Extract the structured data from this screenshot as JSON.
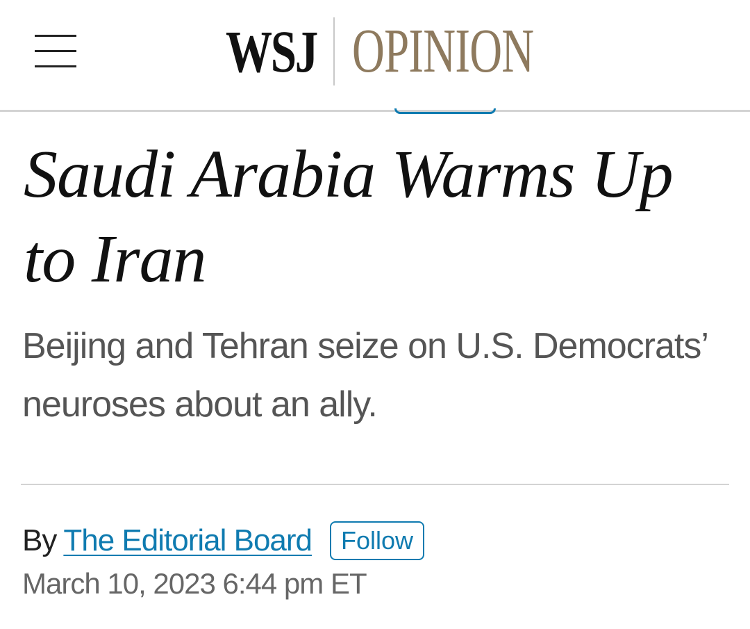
{
  "header": {
    "menu_icon": "hamburger-menu-icon",
    "logo_wsj": "WSJ",
    "logo_section": "OPINION"
  },
  "article": {
    "headline": "Saudi Arabia Warms Up to Iran",
    "dek": "Beijing and Tehran seize on U.S. Democrats’ neuroses about an ally.",
    "byline_prefix": "By",
    "author": "The Editorial Board",
    "follow_label": "Follow",
    "date": "March 10, 2023 6:44 pm ET"
  },
  "colors": {
    "opinion_gold": "#8e7a5e",
    "link_blue": "#0f7bb0",
    "divider_gray": "#d3d3d3"
  }
}
